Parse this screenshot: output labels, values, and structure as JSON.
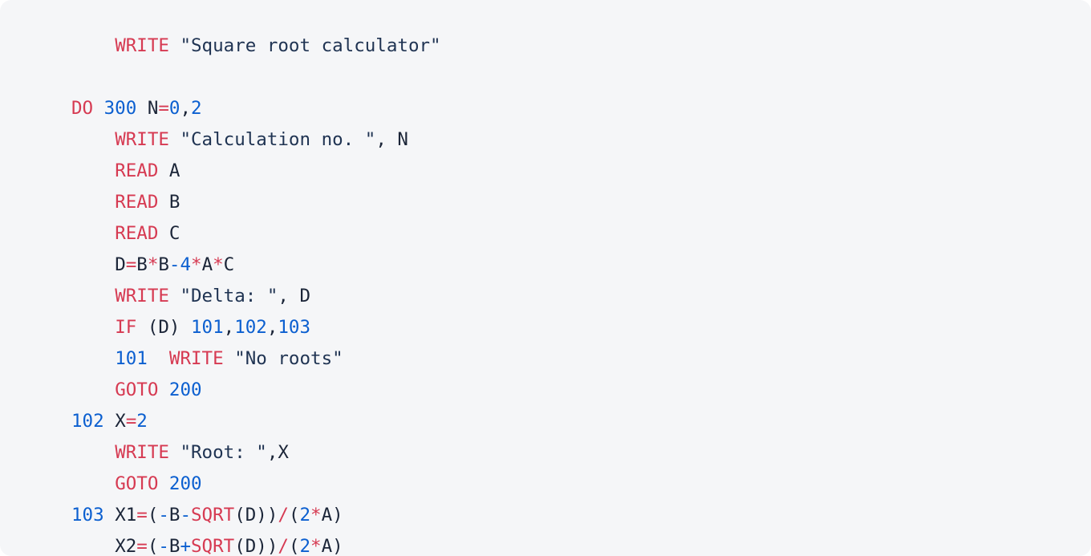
{
  "editor": {
    "language": "fortran",
    "background_color": "#f5f6f8",
    "page_background_color": "#ffffff",
    "colors": {
      "keyword": "#d63a52",
      "function": "#d63a52",
      "operator": "#d63a52",
      "number": "#0b5fd0",
      "label": "#0b5fd0",
      "string": "#1f3352",
      "identifier": "#1b2538",
      "punctuation": "#1b2538"
    }
  },
  "code": {
    "lines": [
      {
        "indent": 4,
        "tokens": [
          {
            "text": "WRITE",
            "kind": "keyword"
          },
          {
            "text": " ",
            "kind": "plain"
          },
          {
            "text": "\"Square root calculator\"",
            "kind": "string"
          }
        ]
      },
      {
        "indent": 0,
        "tokens": []
      },
      {
        "indent": 0,
        "tokens": [
          {
            "text": "DO",
            "kind": "keyword"
          },
          {
            "text": " ",
            "kind": "plain"
          },
          {
            "text": "300",
            "kind": "number"
          },
          {
            "text": " ",
            "kind": "plain"
          },
          {
            "text": "N",
            "kind": "identifier"
          },
          {
            "text": "=",
            "kind": "operator"
          },
          {
            "text": "0",
            "kind": "number"
          },
          {
            "text": ",",
            "kind": "punctuation"
          },
          {
            "text": "2",
            "kind": "number"
          }
        ]
      },
      {
        "indent": 4,
        "tokens": [
          {
            "text": "WRITE",
            "kind": "keyword"
          },
          {
            "text": " ",
            "kind": "plain"
          },
          {
            "text": "\"Calculation no. \"",
            "kind": "string"
          },
          {
            "text": ", ",
            "kind": "punctuation"
          },
          {
            "text": "N",
            "kind": "identifier"
          }
        ]
      },
      {
        "indent": 4,
        "tokens": [
          {
            "text": "READ",
            "kind": "keyword"
          },
          {
            "text": " ",
            "kind": "plain"
          },
          {
            "text": "A",
            "kind": "identifier"
          }
        ]
      },
      {
        "indent": 4,
        "tokens": [
          {
            "text": "READ",
            "kind": "keyword"
          },
          {
            "text": " ",
            "kind": "plain"
          },
          {
            "text": "B",
            "kind": "identifier"
          }
        ]
      },
      {
        "indent": 4,
        "tokens": [
          {
            "text": "READ",
            "kind": "keyword"
          },
          {
            "text": " ",
            "kind": "plain"
          },
          {
            "text": "C",
            "kind": "identifier"
          }
        ]
      },
      {
        "indent": 4,
        "tokens": [
          {
            "text": "D",
            "kind": "identifier"
          },
          {
            "text": "=",
            "kind": "operator"
          },
          {
            "text": "B",
            "kind": "identifier"
          },
          {
            "text": "*",
            "kind": "operator"
          },
          {
            "text": "B",
            "kind": "identifier"
          },
          {
            "text": "-",
            "kind": "number"
          },
          {
            "text": "4",
            "kind": "number"
          },
          {
            "text": "*",
            "kind": "operator"
          },
          {
            "text": "A",
            "kind": "identifier"
          },
          {
            "text": "*",
            "kind": "operator"
          },
          {
            "text": "C",
            "kind": "identifier"
          }
        ]
      },
      {
        "indent": 4,
        "tokens": [
          {
            "text": "WRITE",
            "kind": "keyword"
          },
          {
            "text": " ",
            "kind": "plain"
          },
          {
            "text": "\"Delta: \"",
            "kind": "string"
          },
          {
            "text": ", ",
            "kind": "punctuation"
          },
          {
            "text": "D",
            "kind": "identifier"
          }
        ]
      },
      {
        "indent": 4,
        "tokens": [
          {
            "text": "IF",
            "kind": "keyword"
          },
          {
            "text": " (",
            "kind": "punctuation"
          },
          {
            "text": "D",
            "kind": "identifier"
          },
          {
            "text": ") ",
            "kind": "punctuation"
          },
          {
            "text": "101",
            "kind": "number"
          },
          {
            "text": ",",
            "kind": "punctuation"
          },
          {
            "text": "102",
            "kind": "number"
          },
          {
            "text": ",",
            "kind": "punctuation"
          },
          {
            "text": "103",
            "kind": "number"
          }
        ]
      },
      {
        "indent": 4,
        "tokens": [
          {
            "text": "101",
            "kind": "label"
          },
          {
            "text": "  ",
            "kind": "plain"
          },
          {
            "text": "WRITE",
            "kind": "keyword"
          },
          {
            "text": " ",
            "kind": "plain"
          },
          {
            "text": "\"No roots\"",
            "kind": "string"
          }
        ]
      },
      {
        "indent": 4,
        "tokens": [
          {
            "text": "GOTO",
            "kind": "keyword"
          },
          {
            "text": " ",
            "kind": "plain"
          },
          {
            "text": "200",
            "kind": "number"
          }
        ]
      },
      {
        "indent": 0,
        "tokens": [
          {
            "text": "102",
            "kind": "label"
          },
          {
            "text": " ",
            "kind": "plain"
          },
          {
            "text": "X",
            "kind": "identifier"
          },
          {
            "text": "=",
            "kind": "operator"
          },
          {
            "text": "2",
            "kind": "number"
          }
        ]
      },
      {
        "indent": 4,
        "tokens": [
          {
            "text": "WRITE",
            "kind": "keyword"
          },
          {
            "text": " ",
            "kind": "plain"
          },
          {
            "text": "\"Root: \"",
            "kind": "string"
          },
          {
            "text": ",",
            "kind": "punctuation"
          },
          {
            "text": "X",
            "kind": "identifier"
          }
        ]
      },
      {
        "indent": 4,
        "tokens": [
          {
            "text": "GOTO",
            "kind": "keyword"
          },
          {
            "text": " ",
            "kind": "plain"
          },
          {
            "text": "200",
            "kind": "number"
          }
        ]
      },
      {
        "indent": 0,
        "tokens": [
          {
            "text": "103",
            "kind": "label"
          },
          {
            "text": " ",
            "kind": "plain"
          },
          {
            "text": "X1",
            "kind": "identifier"
          },
          {
            "text": "=",
            "kind": "operator"
          },
          {
            "text": "(",
            "kind": "punctuation"
          },
          {
            "text": "-",
            "kind": "number"
          },
          {
            "text": "B",
            "kind": "identifier"
          },
          {
            "text": "-",
            "kind": "number"
          },
          {
            "text": "SQRT",
            "kind": "function"
          },
          {
            "text": "(",
            "kind": "punctuation"
          },
          {
            "text": "D",
            "kind": "identifier"
          },
          {
            "text": "))",
            "kind": "punctuation"
          },
          {
            "text": "/",
            "kind": "operator"
          },
          {
            "text": "(",
            "kind": "punctuation"
          },
          {
            "text": "2",
            "kind": "number"
          },
          {
            "text": "*",
            "kind": "operator"
          },
          {
            "text": "A",
            "kind": "identifier"
          },
          {
            "text": ")",
            "kind": "punctuation"
          }
        ]
      },
      {
        "indent": 4,
        "tokens": [
          {
            "text": "X2",
            "kind": "identifier"
          },
          {
            "text": "=",
            "kind": "operator"
          },
          {
            "text": "(",
            "kind": "punctuation"
          },
          {
            "text": "-",
            "kind": "number"
          },
          {
            "text": "B",
            "kind": "identifier"
          },
          {
            "text": "+",
            "kind": "number"
          },
          {
            "text": "SQRT",
            "kind": "function"
          },
          {
            "text": "(",
            "kind": "punctuation"
          },
          {
            "text": "D",
            "kind": "identifier"
          },
          {
            "text": "))",
            "kind": "punctuation"
          },
          {
            "text": "/",
            "kind": "operator"
          },
          {
            "text": "(",
            "kind": "punctuation"
          },
          {
            "text": "2",
            "kind": "number"
          },
          {
            "text": "*",
            "kind": "operator"
          },
          {
            "text": "A",
            "kind": "identifier"
          },
          {
            "text": ")",
            "kind": "punctuation"
          }
        ]
      }
    ]
  }
}
